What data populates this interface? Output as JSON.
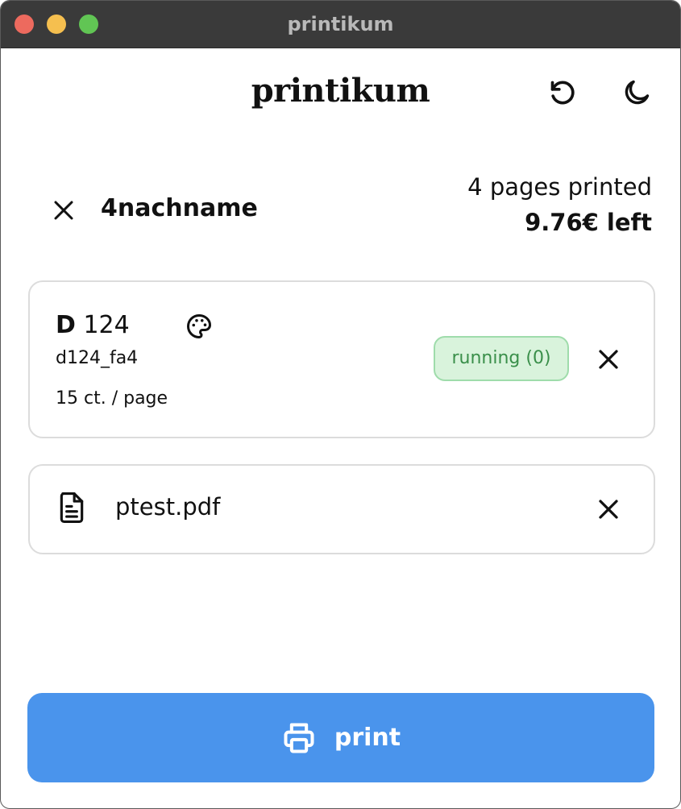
{
  "window": {
    "title": "printikum"
  },
  "header": {
    "brand": "printikum",
    "icons": {
      "reload": "reload-icon",
      "theme": "moon-icon"
    }
  },
  "user": {
    "name": "4nachname",
    "pages_printed": "4 pages printed",
    "balance": "9.76€ left",
    "icons": {
      "close": "close-icon"
    }
  },
  "printer": {
    "name_bold": "D",
    "name_rest": " 124",
    "id": "d124_fa4",
    "price": "15 ct. / page",
    "status": "running (0)",
    "status_color": "#3a8f4a",
    "icons": {
      "color": "palette-icon",
      "remove": "close-icon"
    }
  },
  "file": {
    "name": "ptest.pdf",
    "icons": {
      "file": "document-icon",
      "remove": "close-icon"
    }
  },
  "print_button": {
    "label": "print",
    "color": "#4a94ec",
    "icon": "printer-icon"
  }
}
